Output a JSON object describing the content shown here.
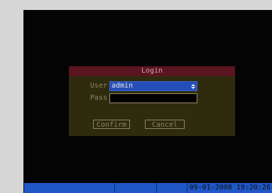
{
  "login_dialog": {
    "title": "Login",
    "user_label": "User",
    "user_value": "admin",
    "pass_label": "Pass",
    "pass_value": "",
    "confirm_label": "Confirm",
    "cancel_label": "Cancel"
  },
  "status_bar": {
    "datetime": "09-01-2008 19:20:26"
  },
  "colors": {
    "screen_bg": "#040404",
    "dialog_bg": "#2f2b0f",
    "title_bar": "#5a1520",
    "selection_blue": "#254fb8",
    "status_blue": "#1f57c7"
  },
  "icons": {
    "user_select_arrow": "up-down-spinner-icon"
  }
}
